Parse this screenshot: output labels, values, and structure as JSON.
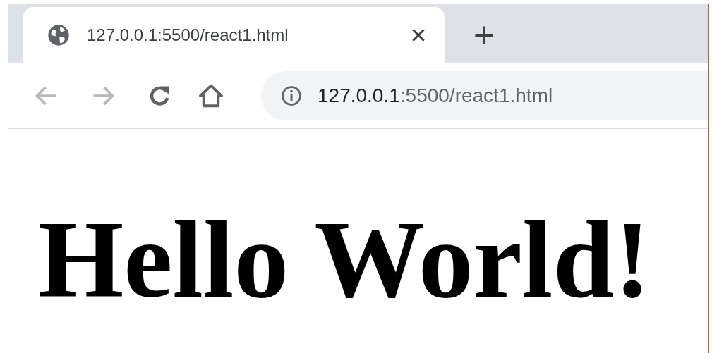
{
  "tab": {
    "title": "127.0.0.1:5500/react1.html",
    "selected": true
  },
  "toolbar": {
    "buttons": [
      {
        "kind": "back",
        "disabled": true
      },
      {
        "kind": "forward",
        "disabled": true
      },
      {
        "kind": "reload",
        "disabled": false
      },
      {
        "kind": "home",
        "disabled": false
      }
    ]
  },
  "address": {
    "host": "127.0.0.1",
    "path": ":5500/react1.html"
  },
  "page": {
    "heading": "Hello World!"
  }
}
